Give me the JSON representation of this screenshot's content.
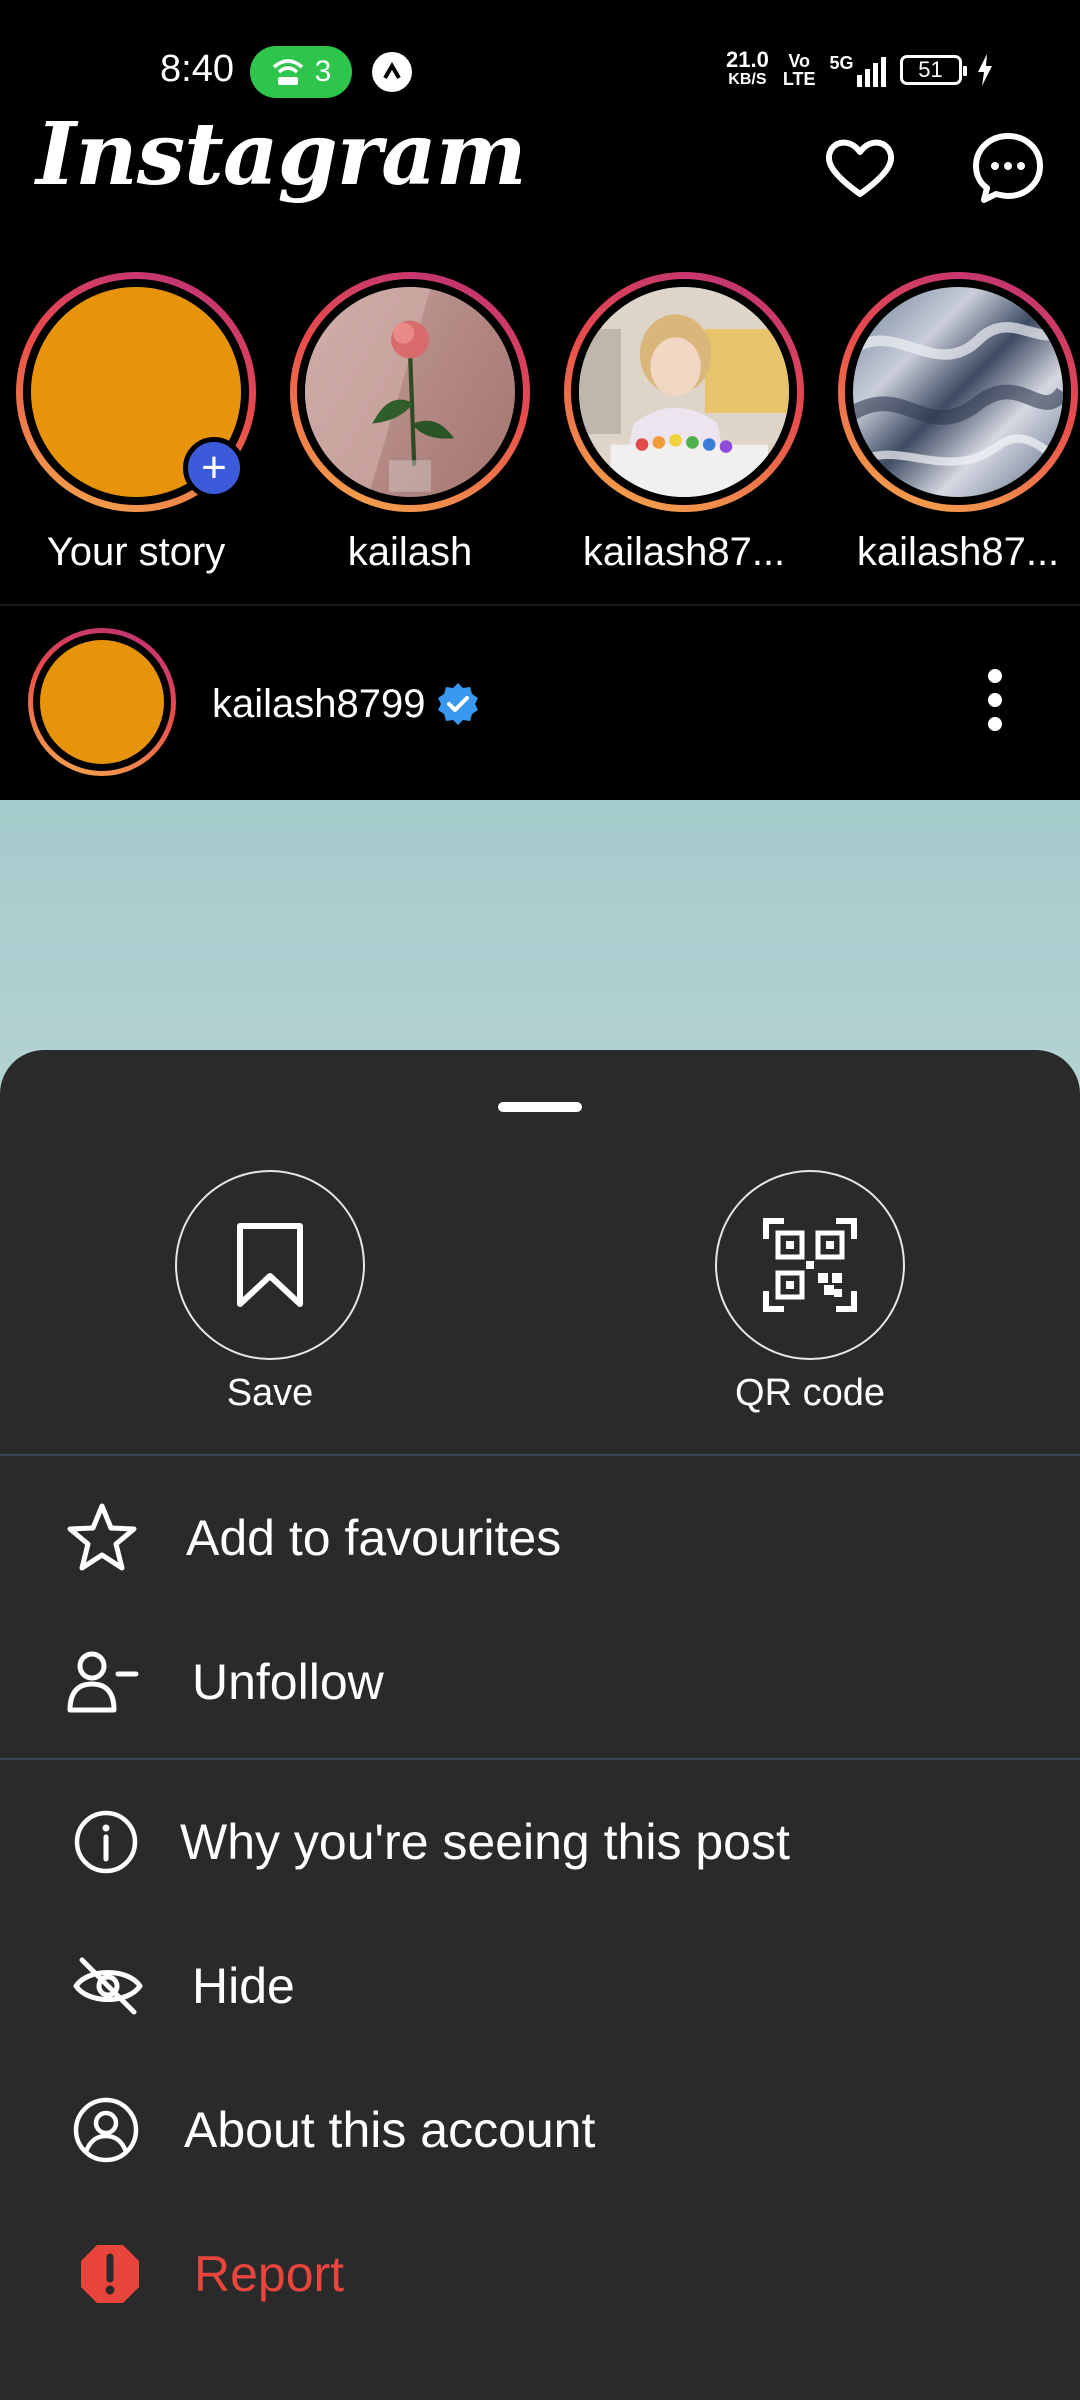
{
  "status_bar": {
    "time": "8:40",
    "hotspot_count": "3",
    "speed_value": "21.0",
    "speed_unit": "KB/S",
    "volte_top": "Vo",
    "volte_bottom": "LTE",
    "network": "5G",
    "battery": "51"
  },
  "header": {
    "logo": "Instagram",
    "icons": [
      "heart-icon",
      "messenger-icon"
    ]
  },
  "stories": [
    {
      "label": "Your story",
      "avatar_color": "#e8940a"
    },
    {
      "label": "kailash"
    },
    {
      "label": "kailash87..."
    },
    {
      "label": "kailash87..."
    }
  ],
  "post": {
    "username": "kailash8799",
    "verified_color": "#3897f0",
    "avatar_color": "#e8940a"
  },
  "sheet": {
    "actions": [
      {
        "label": "Save",
        "icon": "bookmark-icon"
      },
      {
        "label": "QR code",
        "icon": "qr-code-icon"
      }
    ],
    "group1": [
      {
        "label": "Add to favourites",
        "icon": "star-icon"
      },
      {
        "label": "Unfollow",
        "icon": "person-minus-icon"
      }
    ],
    "group2": [
      {
        "label": "Why you're seeing this post",
        "icon": "info-icon"
      },
      {
        "label": "Hide",
        "icon": "eye-off-icon"
      },
      {
        "label": "About this account",
        "icon": "account-circle-icon"
      },
      {
        "label": "Report",
        "icon": "report-icon"
      }
    ]
  },
  "colors": {
    "sheet_bg": "#2a2a2a",
    "report_red": "#e8453c",
    "hotspot_green": "#2fc44c"
  }
}
